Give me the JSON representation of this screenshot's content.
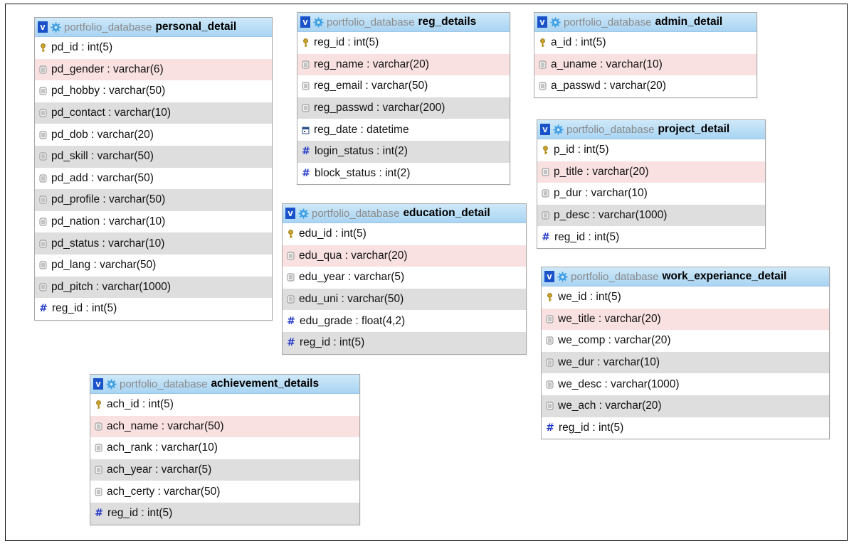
{
  "db_name": "portfolio_database",
  "colors": {
    "header_from": "#cfe9f9",
    "header_to": "#a9d4f3",
    "v_badge": "#1a52c9",
    "row_alt": "#dedede",
    "row_highlight": "#f9e1e1",
    "hash_icon": "#2339c8"
  },
  "tables": [
    {
      "id": "personal_detail",
      "name": "personal_detail",
      "columns": [
        {
          "text": "pd_id : int(5)",
          "icon": "key-icon"
        },
        {
          "text": "pd_gender : varchar(6)",
          "icon": "text-field-icon"
        },
        {
          "text": "pd_hobby : varchar(50)",
          "icon": "text-field-icon"
        },
        {
          "text": "pd_contact : varchar(10)",
          "icon": "text-field-icon"
        },
        {
          "text": "pd_dob : varchar(20)",
          "icon": "text-field-icon"
        },
        {
          "text": "pd_skill : varchar(50)",
          "icon": "text-field-icon"
        },
        {
          "text": "pd_add : varchar(50)",
          "icon": "text-field-icon"
        },
        {
          "text": "pd_profile : varchar(50)",
          "icon": "text-field-icon"
        },
        {
          "text": "pd_nation : varchar(10)",
          "icon": "text-field-icon"
        },
        {
          "text": "pd_status : varchar(10)",
          "icon": "text-field-icon"
        },
        {
          "text": "pd_lang : varchar(50)",
          "icon": "text-field-icon"
        },
        {
          "text": "pd_pitch : varchar(1000)",
          "icon": "text-field-icon"
        },
        {
          "text": "reg_id : int(5)",
          "icon": "hash-icon"
        }
      ]
    },
    {
      "id": "reg_details",
      "name": "reg_details",
      "columns": [
        {
          "text": "reg_id : int(5)",
          "icon": "key-icon"
        },
        {
          "text": "reg_name : varchar(20)",
          "icon": "text-field-icon"
        },
        {
          "text": "reg_email : varchar(50)",
          "icon": "text-field-icon"
        },
        {
          "text": "reg_passwd : varchar(200)",
          "icon": "text-field-icon"
        },
        {
          "text": "reg_date : datetime",
          "icon": "calendar-icon"
        },
        {
          "text": "login_status : int(2)",
          "icon": "hash-icon"
        },
        {
          "text": "block_status : int(2)",
          "icon": "hash-icon"
        }
      ]
    },
    {
      "id": "admin_detail",
      "name": "admin_detail",
      "columns": [
        {
          "text": "a_id : int(5)",
          "icon": "key-icon"
        },
        {
          "text": "a_uname : varchar(10)",
          "icon": "text-field-icon"
        },
        {
          "text": "a_passwd : varchar(20)",
          "icon": "text-field-icon"
        }
      ]
    },
    {
      "id": "project_detail",
      "name": "project_detail",
      "columns": [
        {
          "text": "p_id : int(5)",
          "icon": "key-icon"
        },
        {
          "text": "p_title : varchar(20)",
          "icon": "text-field-icon"
        },
        {
          "text": "p_dur : varchar(10)",
          "icon": "text-field-icon"
        },
        {
          "text": "p_desc : varchar(1000)",
          "icon": "text-field-icon"
        },
        {
          "text": "reg_id : int(5)",
          "icon": "hash-icon"
        }
      ]
    },
    {
      "id": "education_detail",
      "name": "education_detail",
      "columns": [
        {
          "text": "edu_id : int(5)",
          "icon": "key-icon"
        },
        {
          "text": "edu_qua : varchar(20)",
          "icon": "text-field-icon"
        },
        {
          "text": "edu_year : varchar(5)",
          "icon": "text-field-icon"
        },
        {
          "text": "edu_uni : varchar(50)",
          "icon": "text-field-icon"
        },
        {
          "text": "edu_grade : float(4,2)",
          "icon": "hash-icon"
        },
        {
          "text": "reg_id : int(5)",
          "icon": "hash-icon"
        }
      ]
    },
    {
      "id": "work_experiance_detail",
      "name": "work_experiance_detail",
      "columns": [
        {
          "text": "we_id : int(5)",
          "icon": "key-icon"
        },
        {
          "text": "we_title : varchar(20)",
          "icon": "text-field-icon"
        },
        {
          "text": "we_comp : varchar(20)",
          "icon": "text-field-icon"
        },
        {
          "text": "we_dur : varchar(10)",
          "icon": "text-field-icon"
        },
        {
          "text": "we_desc : varchar(1000)",
          "icon": "text-field-icon"
        },
        {
          "text": "we_ach : varchar(20)",
          "icon": "text-field-icon"
        },
        {
          "text": "reg_id : int(5)",
          "icon": "hash-icon"
        }
      ]
    },
    {
      "id": "achievement_details",
      "name": "achievement_details",
      "columns": [
        {
          "text": "ach_id : int(5)",
          "icon": "key-icon"
        },
        {
          "text": "ach_name : varchar(50)",
          "icon": "text-field-icon"
        },
        {
          "text": "ach_rank : varchar(10)",
          "icon": "text-field-icon"
        },
        {
          "text": "ach_year : varchar(5)",
          "icon": "text-field-icon"
        },
        {
          "text": "ach_certy : varchar(50)",
          "icon": "text-field-icon"
        },
        {
          "text": "reg_id : int(5)",
          "icon": "hash-icon"
        }
      ]
    }
  ]
}
